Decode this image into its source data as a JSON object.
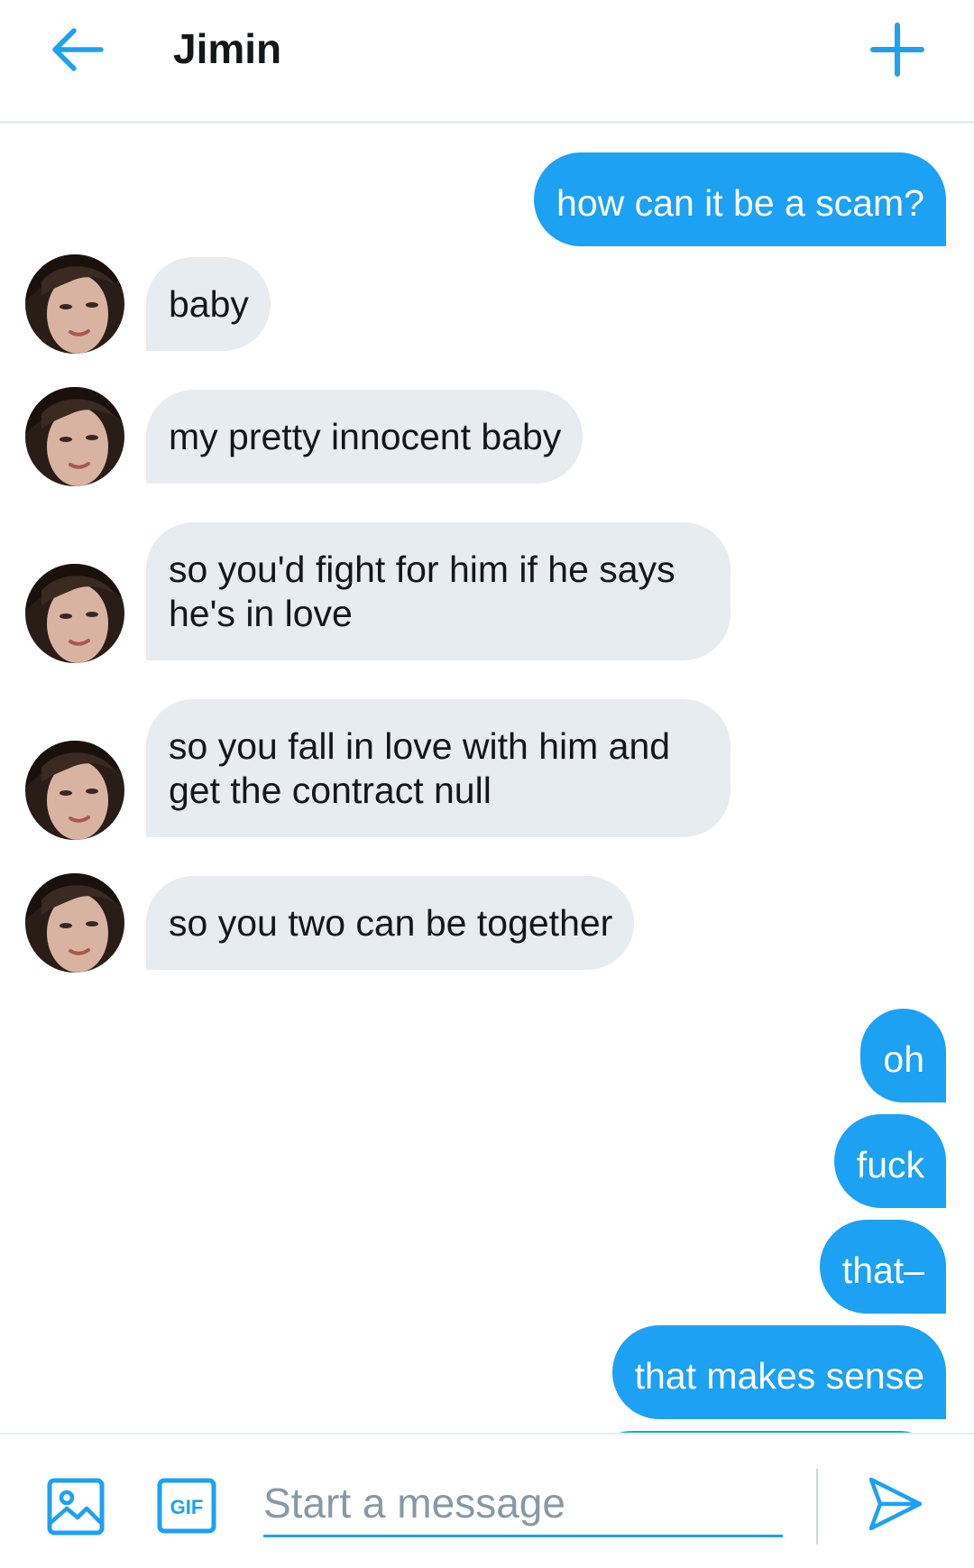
{
  "header": {
    "title": "Jimin",
    "back_icon": "arrow-left-icon",
    "new_icon": "plus-icon"
  },
  "colors": {
    "accent": "#1da1f2",
    "incoming_bubble": "#e6ecf0",
    "outgoing_text": "#ffffff",
    "text": "#14171a",
    "placeholder": "#8899a6"
  },
  "messages": [
    {
      "direction": "out",
      "text": "how can it be a scam?"
    },
    {
      "direction": "in",
      "lines": [
        "baby"
      ]
    },
    {
      "direction": "in",
      "lines": [
        "my pretty innocent baby"
      ]
    },
    {
      "direction": "in",
      "lines": [
        "so you'd fight for him if he says",
        "he's in love"
      ]
    },
    {
      "direction": "in",
      "lines": [
        "so you fall in love with him and",
        "get the contract null"
      ]
    },
    {
      "direction": "in",
      "lines": [
        "so you two can be together"
      ]
    },
    {
      "direction": "out",
      "text": "oh"
    },
    {
      "direction": "out",
      "text": "fuck"
    },
    {
      "direction": "out",
      "text": "that–"
    },
    {
      "direction": "out",
      "text": "that makes sense"
    }
  ],
  "composer": {
    "placeholder": "Start a message",
    "value": "",
    "gif_label": "GIF",
    "image_icon": "image-icon",
    "gif_icon": "gif-icon",
    "send_icon": "send-icon"
  }
}
